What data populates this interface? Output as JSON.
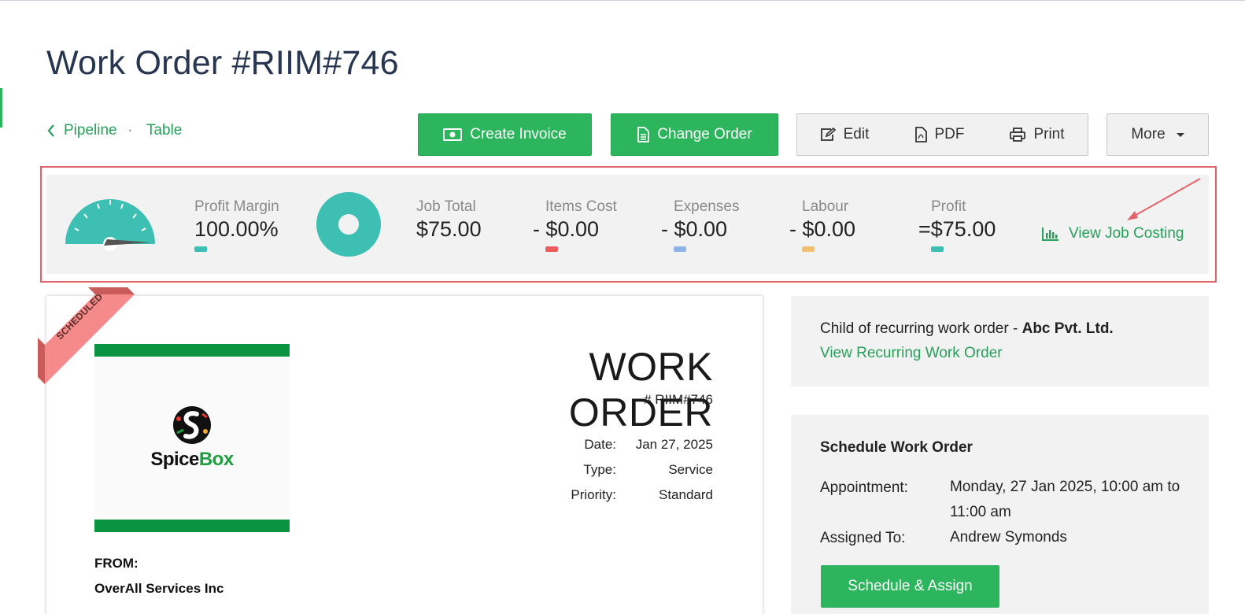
{
  "page": {
    "title": "Work Order #RIIM#746"
  },
  "breadcrumb": {
    "pipeline": "Pipeline",
    "separator": "·",
    "table": "Table"
  },
  "toolbar": {
    "create_invoice": "Create Invoice",
    "change_order": "Change Order",
    "edit": "Edit",
    "pdf": "PDF",
    "print": "Print",
    "more": "More"
  },
  "stats": {
    "profit_margin": {
      "label": "Profit Margin",
      "value": "100.00%"
    },
    "job_total": {
      "label": "Job Total",
      "value": "$75.00"
    },
    "items_cost": {
      "label": "Items Cost",
      "value": "- $0.00"
    },
    "expenses": {
      "label": "Expenses",
      "value": "- $0.00"
    },
    "labour": {
      "label": "Labour",
      "value": "- $0.00"
    },
    "profit": {
      "label": "Profit",
      "value": "=$75.00"
    },
    "view_job_costing": "View Job Costing",
    "colors": {
      "teal": "#3dbfb4",
      "red": "#ee5d5d",
      "blue": "#8fb3e6",
      "orange": "#f2c075"
    }
  },
  "work_order": {
    "ribbon": "SCHEDULED",
    "heading": "WORK ORDER",
    "number": "# RIIM#746",
    "logo": {
      "word1": "Spice",
      "word2": "Box"
    },
    "meta": [
      {
        "key": "Date:",
        "value": "Jan 27, 2025"
      },
      {
        "key": "Type:",
        "value": "Service"
      },
      {
        "key": "Priority:",
        "value": "Standard"
      }
    ],
    "from_label": "FROM:",
    "from_company": "OverAll Services Inc"
  },
  "recurring": {
    "text": "Child of recurring work order - ",
    "company": "Abc Pvt. Ltd.",
    "link": "View Recurring Work Order"
  },
  "schedule": {
    "title": "Schedule Work Order",
    "appointment_label": "Appointment:",
    "appointment_value": "Monday, 27 Jan 2025, 10:00 am to 11:00 am",
    "assigned_label": "Assigned To:",
    "assigned_value": "Andrew Symonds",
    "button": "Schedule & Assign"
  }
}
